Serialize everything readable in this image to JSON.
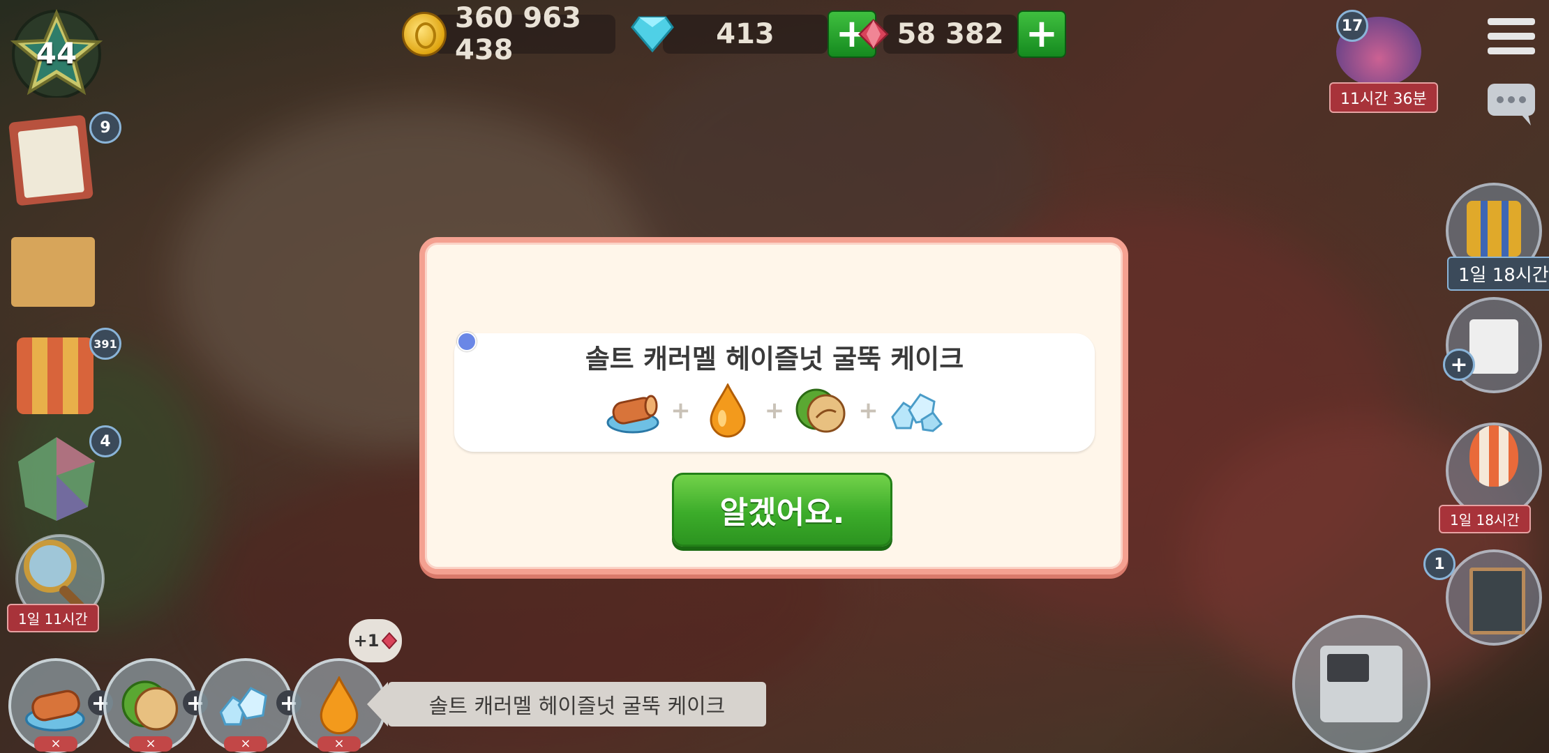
{
  "hud": {
    "level": "44",
    "coins": "360 963 438",
    "diamonds": "413",
    "rubies": "58 382",
    "event_count": "17",
    "event_timer": "11시간 36분"
  },
  "left_panel": {
    "tasks_badge": "9",
    "gifts_badge": "391",
    "gems_badge": "4",
    "search_timer": "1일 11시간"
  },
  "right_panel": {
    "gift_timer": "1일 18시간",
    "balloon_timer": "1일 18시간",
    "cafe_badge": "1"
  },
  "dialog": {
    "recipe_name": "솔트 캐러멜 헤이즐넛 굴뚝 케이크",
    "ingredients": [
      "chimney-cake-icon",
      "caramel-drop-icon",
      "hazelnut-icon",
      "salt-crystals-icon"
    ],
    "ingredient_plus": "+",
    "confirm_label": "알겠어요."
  },
  "bottom": {
    "slot_plus": "+",
    "slot_remove": "×",
    "bubble_text": "+1",
    "order_label": "솔트 캐러멜 헤이즐넛 굴뚝 케이크"
  }
}
